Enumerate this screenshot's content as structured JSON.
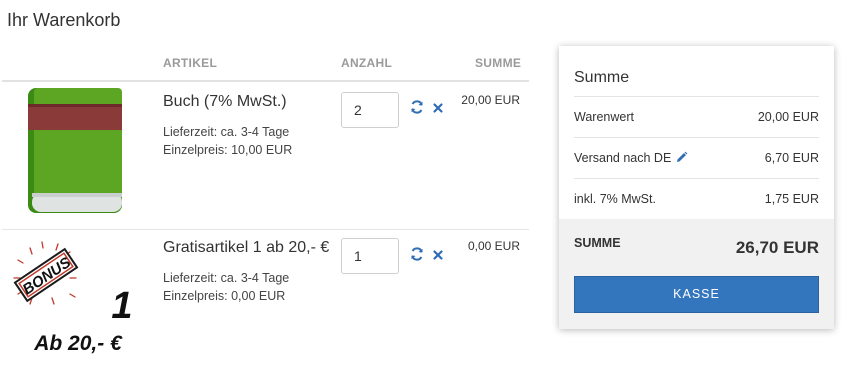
{
  "page": {
    "title": "Ihr Warenkorb"
  },
  "table": {
    "col_article": "ARTIKEL",
    "col_quantity": "ANZAHL",
    "col_sum": "SUMME"
  },
  "items": [
    {
      "name": "Buch (7% MwSt.)",
      "delivery": "Lieferzeit: ca. 3-4 Tage",
      "unit_price": "Einzelpreis: 10,00 EUR",
      "quantity": "2",
      "line_total": "20,00 EUR",
      "image_icon": "green-book-icon"
    },
    {
      "name": "Gratisartikel 1 ab 20,- €",
      "delivery": "Lieferzeit: ca. 3-4 Tage",
      "unit_price": "Einzelpreis: 0,00 EUR",
      "quantity": "1",
      "line_total": "0,00 EUR",
      "image": {
        "badge": "BONUS",
        "number": "1",
        "caption": "Ab 20,- €"
      }
    }
  ],
  "summary": {
    "title": "Summe",
    "rows": [
      {
        "label": "Warenwert",
        "value": "20,00 EUR"
      },
      {
        "label": "Versand nach DE",
        "value": "6,70 EUR"
      },
      {
        "label": "inkl. 7% MwSt.",
        "value": "1,75 EUR"
      }
    ],
    "total_label": "SUMME",
    "total_value": "26,70 EUR",
    "checkout_label": "KASSE"
  },
  "colors": {
    "accent": "#3476bd",
    "icon_blue": "#2f6db5",
    "book_green": "#5ca623",
    "book_band": "#8b3a3a"
  }
}
